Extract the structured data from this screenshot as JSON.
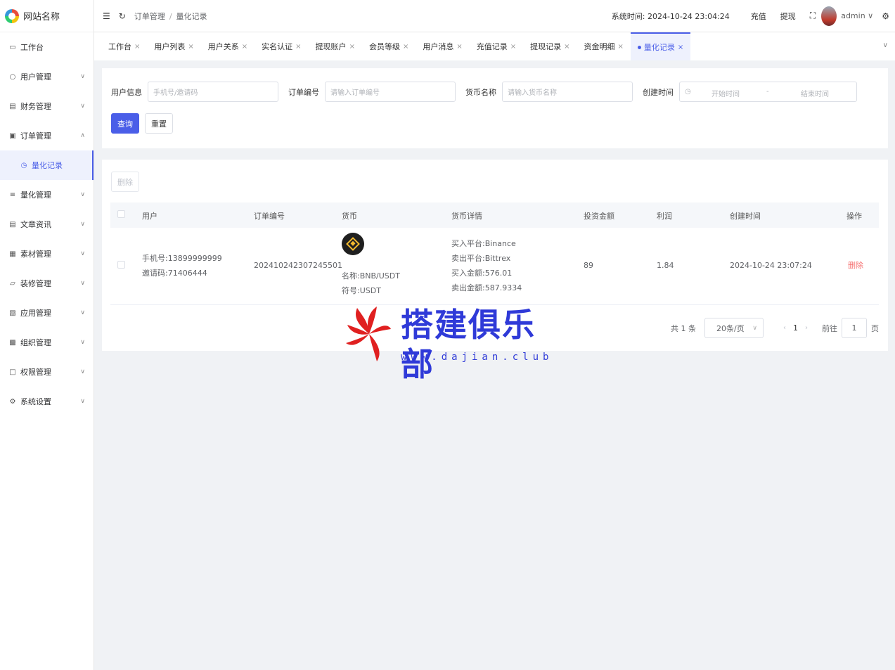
{
  "app": {
    "site_name": "网站名称"
  },
  "sidebar": {
    "items": [
      {
        "label": "工作台",
        "icon": "monitor-icon"
      },
      {
        "label": "用户管理",
        "icon": "user-icon"
      },
      {
        "label": "财务管理",
        "icon": "chart-icon"
      },
      {
        "label": "订单管理",
        "icon": "document-icon"
      },
      {
        "label": "量化记录",
        "icon": "clock-icon"
      },
      {
        "label": "量化管理",
        "icon": "layers-icon"
      },
      {
        "label": "文章资讯",
        "icon": "article-icon"
      },
      {
        "label": "素材管理",
        "icon": "image-icon"
      },
      {
        "label": "装修管理",
        "icon": "brush-icon"
      },
      {
        "label": "应用管理",
        "icon": "apps-icon"
      },
      {
        "label": "组织管理",
        "icon": "building-icon"
      },
      {
        "label": "权限管理",
        "icon": "lock-icon"
      },
      {
        "label": "系统设置",
        "icon": "gear-icon"
      }
    ]
  },
  "header": {
    "breadcrumb": [
      "订单管理",
      "量化记录"
    ],
    "system_time_label": "系统时间:",
    "system_time": "2024-10-24 23:04:24",
    "recharge": "充值",
    "withdraw": "提现",
    "user": "admin"
  },
  "tabs": [
    "工作台",
    "用户列表",
    "用户关系",
    "实名认证",
    "提现账户",
    "会员等级",
    "用户消息",
    "充值记录",
    "提现记录",
    "资金明细",
    "量化记录"
  ],
  "search": {
    "user_label": "用户信息",
    "user_placeholder": "手机号/邀请码",
    "order_label": "订单编号",
    "order_placeholder": "请输入订单编号",
    "coin_label": "货币名称",
    "coin_placeholder": "请输入货币名称",
    "time_label": "创建时间",
    "start_placeholder": "开始时间",
    "range_sep": "-",
    "end_placeholder": "结束时间",
    "query_btn": "查询",
    "reset_btn": "重置"
  },
  "table": {
    "delete_btn": "删除",
    "columns": [
      "用户",
      "订单编号",
      "货币",
      "货币详情",
      "投资金额",
      "利润",
      "创建时间",
      "操作"
    ],
    "rows": [
      {
        "phone": "手机号:13899999999",
        "invite": "邀请码:71406444",
        "order_no": "202410242307245501",
        "coin_name": "名称:BNB/USDT",
        "coin_symbol": "符号:USDT",
        "buy_platform": "买入平台:Binance",
        "sell_platform": "卖出平台:Bittrex",
        "buy_amount": "买入金额:576.01",
        "sell_amount": "卖出金额:587.9334",
        "invest": "89",
        "profit": "1.84",
        "created": "2024-10-24 23:07:24",
        "action": "删除"
      }
    ]
  },
  "pagination": {
    "total": "共 1 条",
    "page_size": "20条/页",
    "current": "1",
    "goto_label": "前往",
    "goto_value": "1",
    "page_suffix": "页"
  },
  "watermark": {
    "title": "搭建俱乐部",
    "url": "www.dajian.club"
  },
  "colors": {
    "primary": "#4a5ee8",
    "danger": "#f56c6c",
    "bnb": "#f3ba2f"
  }
}
